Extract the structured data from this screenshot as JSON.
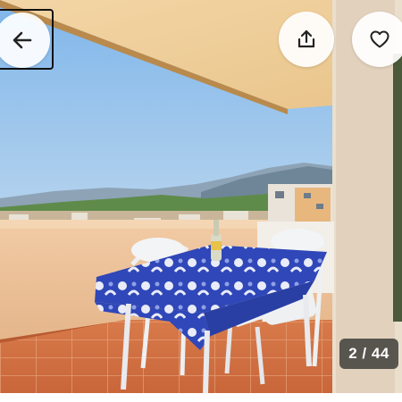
{
  "gallery": {
    "photo_subject": "balcony-sea-view",
    "counter": {
      "current": "2",
      "separator": " / ",
      "total": "44"
    }
  },
  "toolbar": {
    "back_icon": "arrow-left-icon",
    "share_icon": "share-icon",
    "favorite_icon": "heart-icon"
  },
  "colors": {
    "button_bg": "#ffffff",
    "counter_bg": "#222222",
    "counter_text": "#ffffff"
  }
}
